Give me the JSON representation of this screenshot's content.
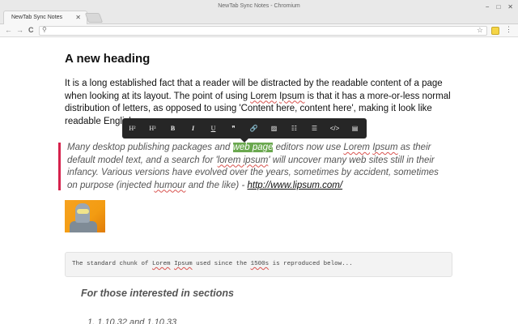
{
  "window": {
    "title": "NewTab Sync Notes - Chromium",
    "controls": [
      "−",
      "□",
      "✕"
    ]
  },
  "tab": {
    "title": "NewTab Sync Notes",
    "close": "✕"
  },
  "toolbar": {
    "back": "←",
    "forward": "→",
    "reload": "C",
    "url": "",
    "search_icon": "magnifier-icon",
    "star": "☆",
    "menu": "⋮"
  },
  "editor": {
    "heading": "A new heading",
    "paragraph": {
      "part1": "It is a long established fact that a reader will be distracted by the readable content of a page when looking at its layout. The point of using ",
      "spell1": "Lorem",
      "part2": " ",
      "spell2": "Ipsum",
      "part3": " is that it has a more-or-less normal distribution of letters, as opposed to using 'Content here, content here', making it look like readable English."
    },
    "formatting_toolbar": [
      {
        "name": "h2-button",
        "label": "H²",
        "style": "serif"
      },
      {
        "name": "h3-button",
        "label": "H³",
        "style": "serif"
      },
      {
        "name": "bold-button",
        "label": "B",
        "style": "bold"
      },
      {
        "name": "italic-button",
        "label": "I",
        "style": "italic"
      },
      {
        "name": "underline-button",
        "label": "U",
        "style": "under"
      },
      {
        "name": "quote-button",
        "label": "❞",
        "style": ""
      },
      {
        "name": "link-button",
        "label": "🔗",
        "style": ""
      },
      {
        "name": "image-button",
        "label": "▨",
        "style": ""
      },
      {
        "name": "ordered-list-button",
        "label": "☷",
        "style": ""
      },
      {
        "name": "unordered-list-button",
        "label": "☰",
        "style": ""
      },
      {
        "name": "code-button",
        "label": "</>",
        "style": ""
      },
      {
        "name": "embed-button",
        "label": "▤",
        "style": ""
      }
    ],
    "blockquote": {
      "part1": "Many desktop publishing packages and ",
      "highlight": "web page",
      "part2": " editors now use ",
      "spell1": "Lorem",
      "part3": " ",
      "spell2": "Ipsum",
      "part4": " as their default model text, and a search for '",
      "spell3": "lorem ipsum",
      "part5": "' will uncover many web sites still in their infancy. Various versions have evolved over the years, sometimes by accident, sometimes on purpose (injected ",
      "spell4": "humour",
      "part6": " and the like) - ",
      "link": "http://www.lipsum.com/"
    },
    "code": {
      "part1": "The standard chunk of ",
      "spell1": "Lorem",
      "part2": " ",
      "spell2": "Ipsum",
      "part3": " used since the ",
      "spell3": "1500s",
      "part4": " is reproduced below..."
    },
    "subheading": "For those interested in sections",
    "list_item": "1. 1.10.32 and 1.10.33"
  },
  "colors": {
    "quote_bar": "#d6224c",
    "highlight": "#6aa84f",
    "toolbar_bg": "#262626"
  }
}
